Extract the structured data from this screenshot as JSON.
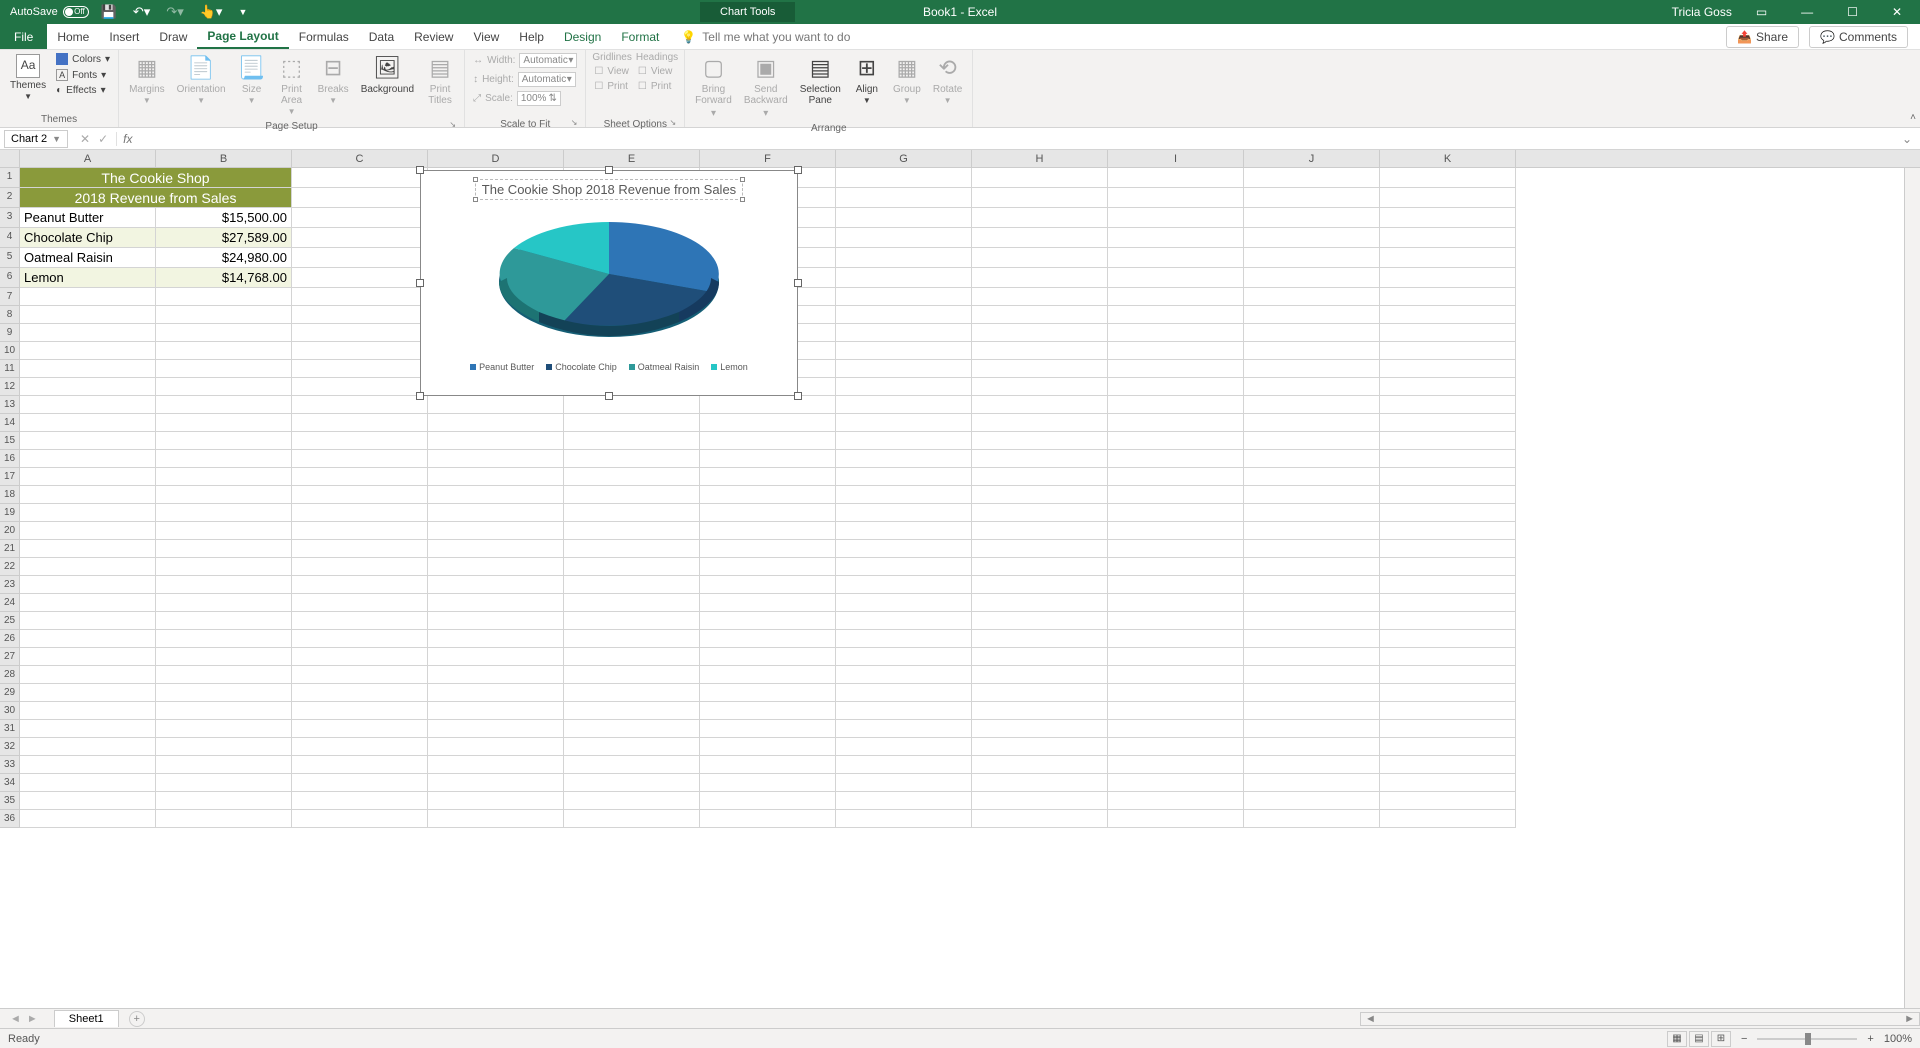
{
  "title_bar": {
    "autosave": "AutoSave",
    "autosave_state": "Off",
    "chart_tools": "Chart Tools",
    "doc_title": "Book1 - Excel",
    "user": "Tricia Goss"
  },
  "tabs": {
    "file": "File",
    "home": "Home",
    "insert": "Insert",
    "draw": "Draw",
    "page_layout": "Page Layout",
    "formulas": "Formulas",
    "data": "Data",
    "review": "Review",
    "view": "View",
    "help": "Help",
    "design": "Design",
    "format": "Format",
    "tell_me": "Tell me what you want to do",
    "share": "Share",
    "comments": "Comments"
  },
  "ribbon": {
    "themes": {
      "themes": "Themes",
      "colors": "Colors",
      "fonts": "Fonts",
      "effects": "Effects",
      "label": "Themes"
    },
    "page_setup": {
      "margins": "Margins",
      "orientation": "Orientation",
      "size": "Size",
      "print_area": "Print\nArea",
      "breaks": "Breaks",
      "background": "Background",
      "print_titles": "Print\nTitles",
      "label": "Page Setup"
    },
    "scale": {
      "width": "Width:",
      "height": "Height:",
      "scale": "Scale:",
      "auto": "Automatic",
      "pct": "100%",
      "label": "Scale to Fit"
    },
    "sheet_opts": {
      "gridlines": "Gridlines",
      "headings": "Headings",
      "view": "View",
      "print": "Print",
      "label": "Sheet Options"
    },
    "arrange": {
      "bring": "Bring\nForward",
      "send": "Send\nBackward",
      "selection": "Selection\nPane",
      "align": "Align",
      "group": "Group",
      "rotate": "Rotate",
      "label": "Arrange"
    }
  },
  "name_box": "Chart 2",
  "columns": [
    "A",
    "B",
    "C",
    "D",
    "E",
    "F",
    "G",
    "H",
    "I",
    "J",
    "K"
  ],
  "data_rows": {
    "title1": "The Cookie Shop",
    "title2": "2018 Revenue from Sales",
    "r3a": "Peanut Butter",
    "r3b": "$15,500.00",
    "r4a": "Chocolate Chip",
    "r4b": "$27,589.00",
    "r5a": "Oatmeal Raisin",
    "r5b": "$24,980.00",
    "r6a": "Lemon",
    "r6b": "$14,768.00"
  },
  "chart": {
    "title": "The Cookie Shop 2018 Revenue from Sales",
    "legend": [
      "Peanut Butter",
      "Chocolate Chip",
      "Oatmeal Raisin",
      "Lemon"
    ],
    "colors": [
      "#2e75b6",
      "#1f4e79",
      "#2e9999",
      "#26c6c6"
    ]
  },
  "chart_data": {
    "type": "pie",
    "title": "The Cookie Shop 2018 Revenue from Sales",
    "categories": [
      "Peanut Butter",
      "Chocolate Chip",
      "Oatmeal Raisin",
      "Lemon"
    ],
    "values": [
      15500.0,
      27589.0,
      24980.0,
      14768.0
    ],
    "colors": [
      "#2e75b6",
      "#1f4e79",
      "#2e9999",
      "#26c6c6"
    ]
  },
  "sheet_tab": "Sheet1",
  "status": {
    "ready": "Ready",
    "zoom": "100%"
  }
}
